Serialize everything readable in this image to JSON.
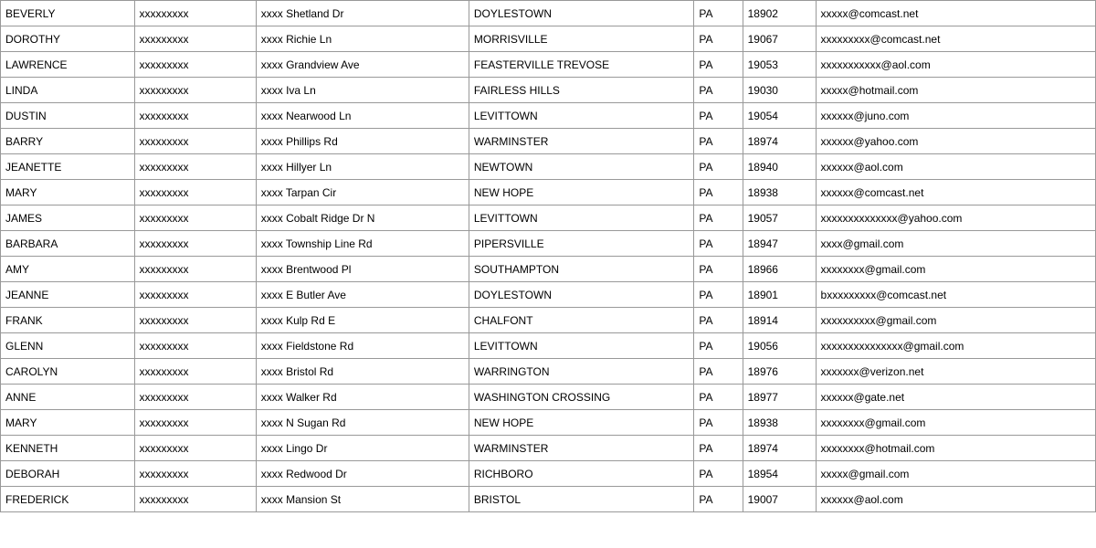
{
  "table": {
    "rows": [
      {
        "first": "BEVERLY",
        "second": "xxxxxxxxx",
        "third": "xxxx Shetland Dr",
        "fourth": "DOYLESTOWN",
        "fifth": "PA",
        "sixth": "18902",
        "seventh": "xxxxx@comcast.net"
      },
      {
        "first": "DOROTHY",
        "second": "xxxxxxxxx",
        "third": "xxxx Richie Ln",
        "fourth": "MORRISVILLE",
        "fifth": "PA",
        "sixth": "19067",
        "seventh": "xxxxxxxxx@comcast.net"
      },
      {
        "first": "LAWRENCE",
        "second": "xxxxxxxxx",
        "third": "xxxx Grandview Ave",
        "fourth": "FEASTERVILLE TREVOSE",
        "fifth": "PA",
        "sixth": "19053",
        "seventh": "xxxxxxxxxxx@aol.com"
      },
      {
        "first": "LINDA",
        "second": "xxxxxxxxx",
        "third": "xxxx Iva Ln",
        "fourth": "FAIRLESS HILLS",
        "fifth": "PA",
        "sixth": "19030",
        "seventh": "xxxxx@hotmail.com"
      },
      {
        "first": "DUSTIN",
        "second": "xxxxxxxxx",
        "third": "xxxx Nearwood Ln",
        "fourth": "LEVITTOWN",
        "fifth": "PA",
        "sixth": "19054",
        "seventh": "xxxxxx@juno.com"
      },
      {
        "first": "BARRY",
        "second": "xxxxxxxxx",
        "third": "xxxx Phillips Rd",
        "fourth": "WARMINSTER",
        "fifth": "PA",
        "sixth": "18974",
        "seventh": "xxxxxx@yahoo.com"
      },
      {
        "first": "JEANETTE",
        "second": "xxxxxxxxx",
        "third": "xxxx Hillyer Ln",
        "fourth": "NEWTOWN",
        "fifth": "PA",
        "sixth": "18940",
        "seventh": "xxxxxx@aol.com"
      },
      {
        "first": "MARY",
        "second": "xxxxxxxxx",
        "third": "xxxx Tarpan Cir",
        "fourth": "NEW HOPE",
        "fifth": "PA",
        "sixth": "18938",
        "seventh": "xxxxxx@comcast.net"
      },
      {
        "first": "JAMES",
        "second": "xxxxxxxxx",
        "third": "xxxx Cobalt Ridge Dr N",
        "fourth": "LEVITTOWN",
        "fifth": "PA",
        "sixth": "19057",
        "seventh": "xxxxxxxxxxxxxx@yahoo.com"
      },
      {
        "first": "BARBARA",
        "second": "xxxxxxxxx",
        "third": "xxxx Township Line Rd",
        "fourth": "PIPERSVILLE",
        "fifth": "PA",
        "sixth": "18947",
        "seventh": "xxxx@gmail.com"
      },
      {
        "first": "AMY",
        "second": "xxxxxxxxx",
        "third": "xxxx Brentwood Pl",
        "fourth": "SOUTHAMPTON",
        "fifth": "PA",
        "sixth": "18966",
        "seventh": "xxxxxxxx@gmail.com"
      },
      {
        "first": "JEANNE",
        "second": "xxxxxxxxx",
        "third": "xxxx E Butler Ave",
        "fourth": "DOYLESTOWN",
        "fifth": "PA",
        "sixth": "18901",
        "seventh": "bxxxxxxxxx@comcast.net"
      },
      {
        "first": "FRANK",
        "second": "xxxxxxxxx",
        "third": "xxxx Kulp Rd E",
        "fourth": "CHALFONT",
        "fifth": "PA",
        "sixth": "18914",
        "seventh": "xxxxxxxxxx@gmail.com"
      },
      {
        "first": "GLENN",
        "second": "xxxxxxxxx",
        "third": "xxxx Fieldstone Rd",
        "fourth": "LEVITTOWN",
        "fifth": "PA",
        "sixth": "19056",
        "seventh": "xxxxxxxxxxxxxxx@gmail.com"
      },
      {
        "first": "CAROLYN",
        "second": "xxxxxxxxx",
        "third": "xxxx Bristol Rd",
        "fourth": "WARRINGTON",
        "fifth": "PA",
        "sixth": "18976",
        "seventh": "xxxxxxx@verizon.net"
      },
      {
        "first": "ANNE",
        "second": "xxxxxxxxx",
        "third": "xxxx Walker Rd",
        "fourth": "WASHINGTON CROSSING",
        "fifth": "PA",
        "sixth": "18977",
        "seventh": "xxxxxx@gate.net"
      },
      {
        "first": "MARY",
        "second": "xxxxxxxxx",
        "third": "xxxx N Sugan Rd",
        "fourth": "NEW HOPE",
        "fifth": "PA",
        "sixth": "18938",
        "seventh": "xxxxxxxx@gmail.com"
      },
      {
        "first": "KENNETH",
        "second": "xxxxxxxxx",
        "third": "xxxx Lingo Dr",
        "fourth": "WARMINSTER",
        "fifth": "PA",
        "sixth": "18974",
        "seventh": "xxxxxxxx@hotmail.com"
      },
      {
        "first": "DEBORAH",
        "second": "xxxxxxxxx",
        "third": "xxxx Redwood Dr",
        "fourth": "RICHBORO",
        "fifth": "PA",
        "sixth": "18954",
        "seventh": "xxxxx@gmail.com"
      },
      {
        "first": "FREDERICK",
        "second": "xxxxxxxxx",
        "third": "xxxx Mansion St",
        "fourth": "BRISTOL",
        "fifth": "PA",
        "sixth": "19007",
        "seventh": "xxxxxx@aol.com"
      }
    ]
  }
}
